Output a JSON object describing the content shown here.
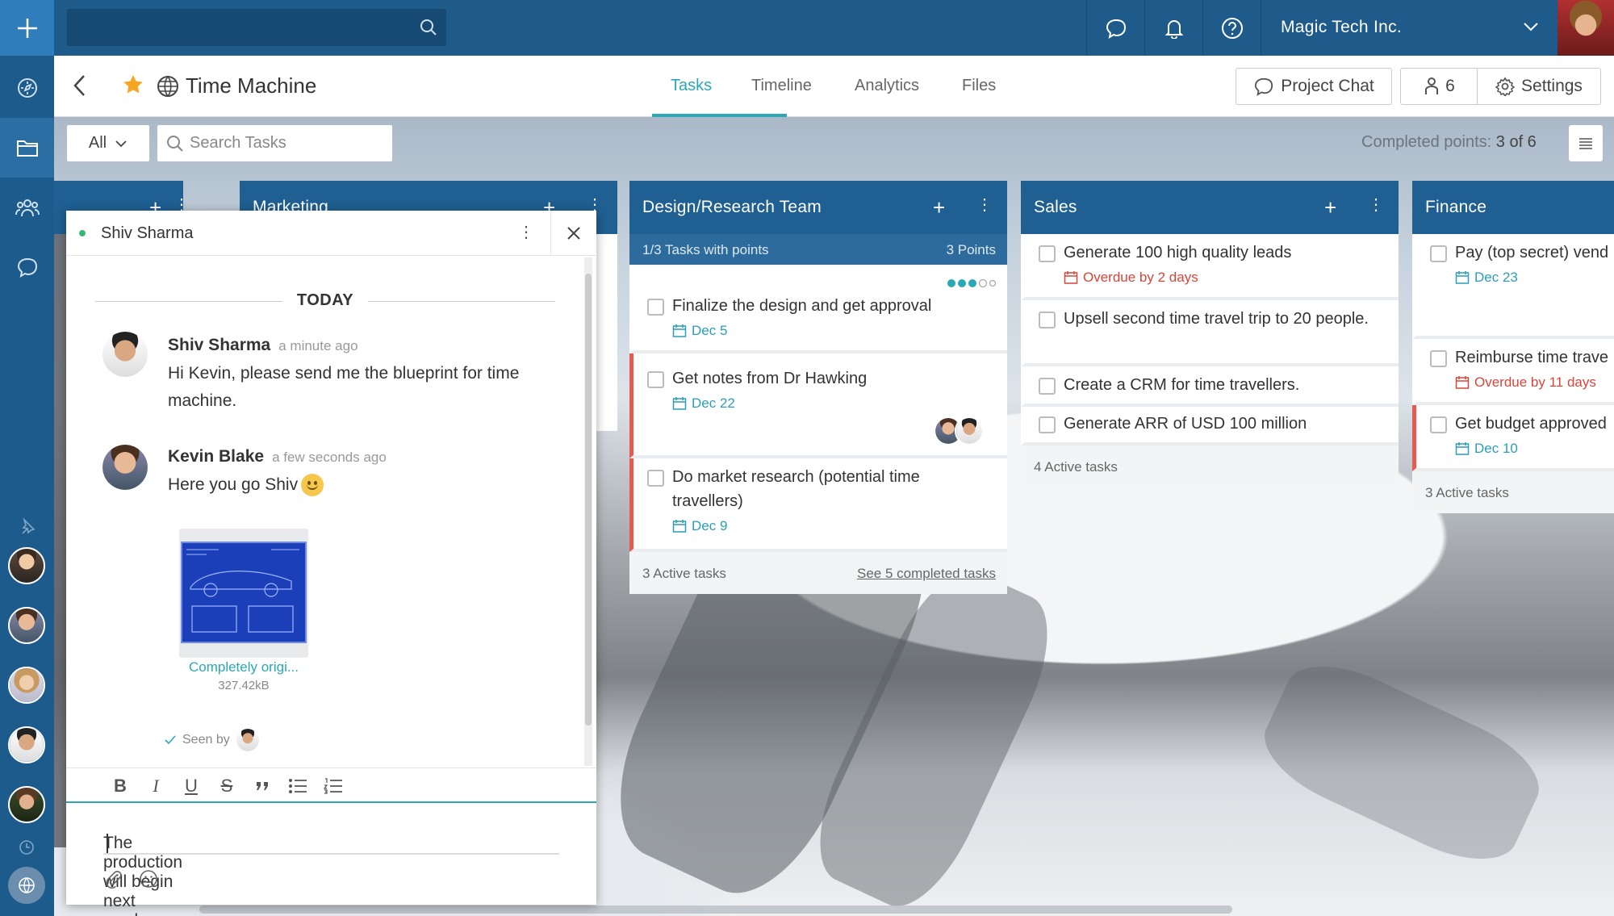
{
  "topbar": {
    "search_placeholder": "",
    "company": "Magic Tech Inc."
  },
  "project": {
    "title": "Time Machine",
    "tabs": [
      {
        "label": "Tasks",
        "active": true
      },
      {
        "label": "Timeline",
        "active": false
      },
      {
        "label": "Analytics",
        "active": false
      },
      {
        "label": "Files",
        "active": false
      }
    ],
    "buttons": {
      "chat": "Project Chat",
      "members": "6",
      "settings": "Settings"
    }
  },
  "filters": {
    "all_label": "All",
    "search_placeholder": "Search Tasks",
    "points_prefix": "Completed points:",
    "points_value": "3 of 6"
  },
  "columns": {
    "hidden1": {
      "title": ""
    },
    "marketing": {
      "title": "Marketing"
    },
    "design": {
      "title": "Design/Research Team",
      "sub_left": "1/3 Tasks with points",
      "sub_right": "3 Points",
      "cards": [
        {
          "title": "Finalize the design and get approval",
          "date": "Dec 5"
        },
        {
          "title": "Get notes from Dr Hawking",
          "date": "Dec 22"
        },
        {
          "title": "Do market research (potential time travellers)",
          "date": "Dec 9"
        }
      ],
      "footer": "3 Active tasks",
      "footer_link": "See 5 completed tasks"
    },
    "sales": {
      "title": "Sales",
      "cards": [
        {
          "title": "Generate 100 high quality leads",
          "date": "Overdue by 2 days"
        },
        {
          "title": "Upsell second time travel trip to 20 people.",
          "date": ""
        },
        {
          "title": "Create a CRM for time travellers.",
          "date": ""
        },
        {
          "title": "Generate ARR of USD 100 million",
          "date": ""
        }
      ],
      "footer": "4 Active tasks"
    },
    "finance": {
      "title": "Finance",
      "cards": [
        {
          "title": "Pay (top secret) vend",
          "date": "Dec 23"
        },
        {
          "title": "Reimburse time trave",
          "date": "Overdue by 11 days"
        },
        {
          "title": "Get budget approved",
          "date": "Dec 10"
        }
      ],
      "footer": "3 Active tasks"
    }
  },
  "chat": {
    "contact": "Shiv Sharma",
    "day_label": "TODAY",
    "messages": [
      {
        "author": "Shiv Sharma",
        "time": "a minute ago",
        "text": "Hi Kevin, please send me the blueprint for time machine."
      },
      {
        "author": "Kevin Blake",
        "time": "a few seconds ago",
        "text": "Here you go Shiv"
      }
    ],
    "attachment": {
      "name": "Completely origi...",
      "size": "327.42kB"
    },
    "seen_label": "Seen by",
    "composer_text": "The production will begin next week."
  },
  "colors": {
    "rail": "#1d5b8c",
    "topbar": "#1e5a8a",
    "column_header": "#1f5f92",
    "accent": "#2aa8b5",
    "overdue": "#d9453a"
  }
}
